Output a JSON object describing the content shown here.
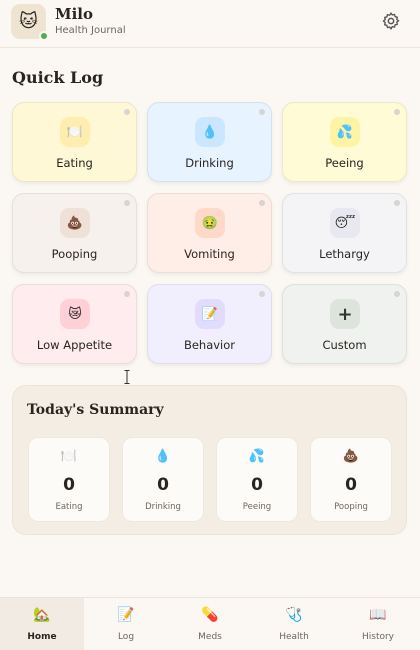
{
  "header": {
    "pet_name": "Milo",
    "subtitle": "Health Journal",
    "avatar_icon": "🐱",
    "settings_icon": "gear-icon"
  },
  "quick_log": {
    "title": "Quick Log",
    "tiles": [
      {
        "label": "Eating",
        "icon": "🍽️"
      },
      {
        "label": "Drinking",
        "icon": "💧"
      },
      {
        "label": "Peeing",
        "icon": "💦"
      },
      {
        "label": "Pooping",
        "icon": "💩"
      },
      {
        "label": "Vomiting",
        "icon": "🤢"
      },
      {
        "label": "Lethargy",
        "icon": "😴"
      },
      {
        "label": "Low Appetite",
        "icon": "😿"
      },
      {
        "label": "Behavior",
        "icon": "📝"
      },
      {
        "label": "Custom",
        "icon": "+"
      }
    ]
  },
  "summary": {
    "title": "Today's Summary",
    "stats": [
      {
        "label": "Eating",
        "value": "0",
        "icon": "🍽️"
      },
      {
        "label": "Drinking",
        "value": "0",
        "icon": "💧"
      },
      {
        "label": "Peeing",
        "value": "0",
        "icon": "💦"
      },
      {
        "label": "Pooping",
        "value": "0",
        "icon": "💩"
      }
    ]
  },
  "nav": {
    "items": [
      {
        "label": "Home",
        "icon": "🏡",
        "active": true
      },
      {
        "label": "Log",
        "icon": "📝",
        "active": false
      },
      {
        "label": "Meds",
        "icon": "💊",
        "active": false
      },
      {
        "label": "Health",
        "icon": "🩺",
        "active": false
      },
      {
        "label": "History",
        "icon": "📖",
        "active": false
      }
    ]
  },
  "colors": {
    "background": "#fbf7f2",
    "status_online": "#4caf50"
  }
}
